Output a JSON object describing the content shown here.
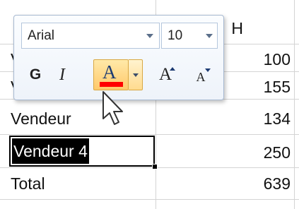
{
  "sheet": {
    "header_right": "H",
    "rows": [
      {
        "label": "V",
        "value": "100"
      },
      {
        "label": "V",
        "value": "155"
      },
      {
        "label": "Vendeur",
        "value": "134"
      },
      {
        "label": "Vendeur 4",
        "value": "250"
      },
      {
        "label": "Total",
        "value": "639"
      }
    ]
  },
  "mini_toolbar": {
    "font_name": "Arial",
    "font_size": "10",
    "bold_label": "G",
    "italic_label": "I",
    "font_color_label": "A",
    "font_color": "#ff0000",
    "grow_label": "A",
    "shrink_label": "A"
  },
  "icons": {
    "cursor": "mouse-pointer-icon"
  }
}
